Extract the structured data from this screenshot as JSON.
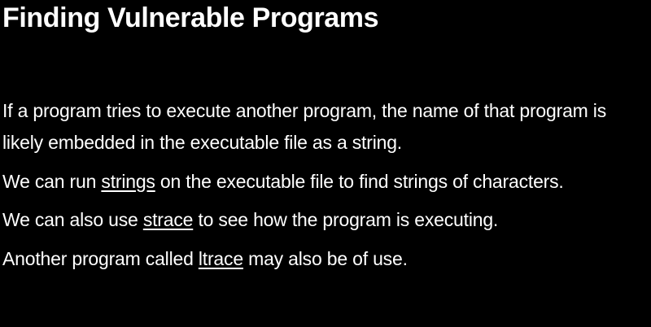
{
  "slide": {
    "title": "Finding Vulnerable Programs",
    "paragraphs": [
      {
        "text": "If a program tries to execute another program, the name of that program is likely embedded in the executable file as a string."
      },
      {
        "before": "We can run ",
        "command": "strings",
        "after": " on the executable file to find strings of characters."
      },
      {
        "before": "We can also use ",
        "command": "strace",
        "after": " to see how the program is executing."
      },
      {
        "before": "Another program called ",
        "command": "ltrace",
        "after": " may also be of use."
      }
    ]
  }
}
